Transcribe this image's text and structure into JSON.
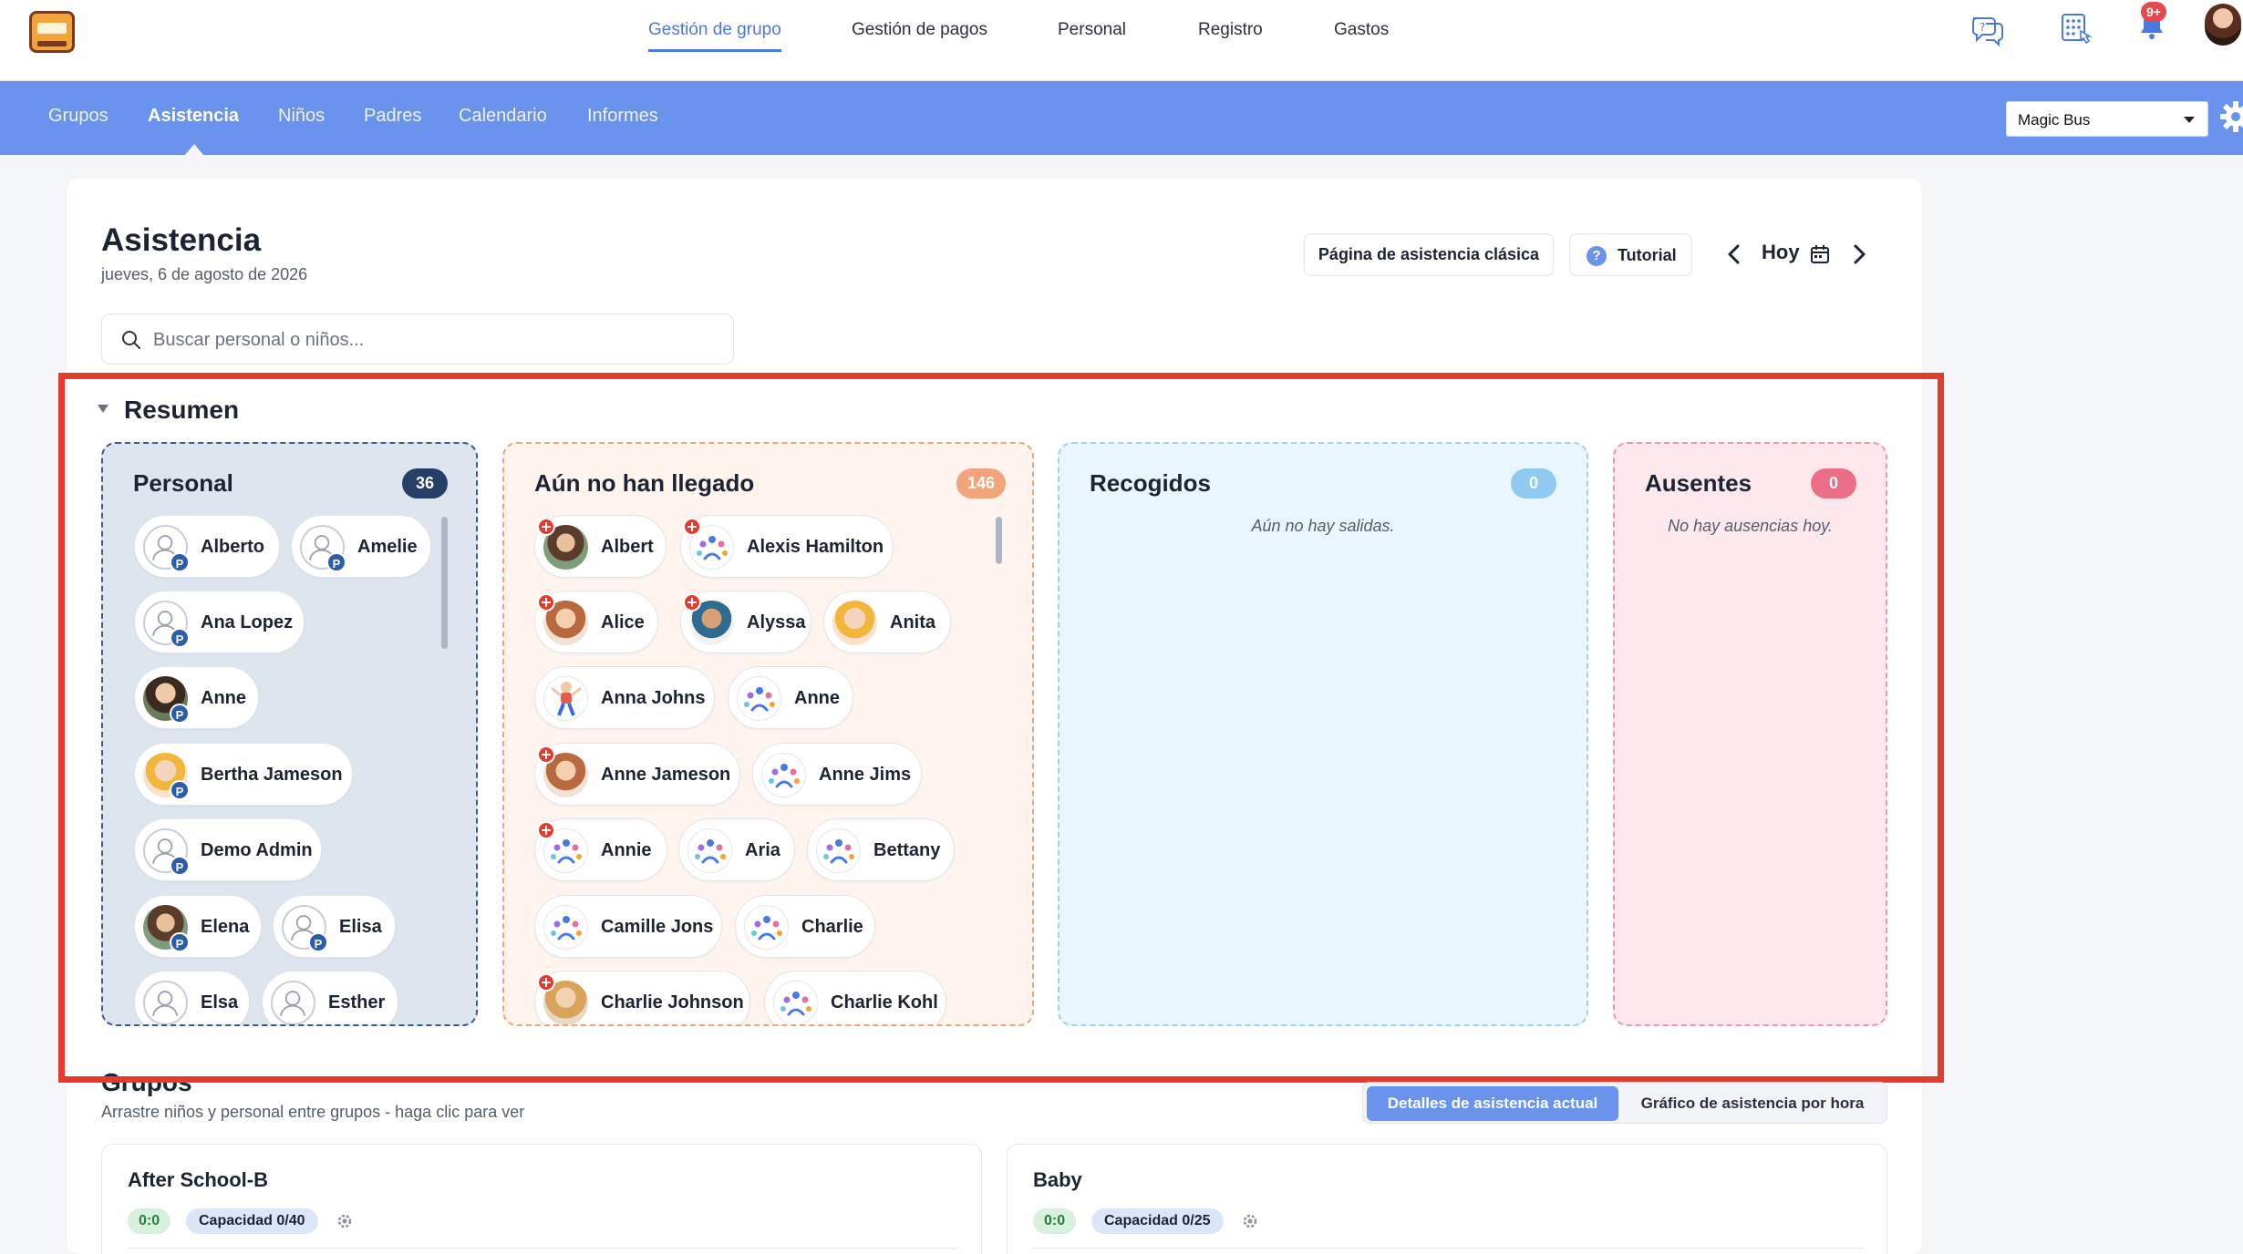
{
  "top_nav": {
    "items": [
      "Gestión de grupo",
      "Gestión de pagos",
      "Personal",
      "Registro",
      "Gastos"
    ],
    "active": "Gestión de grupo",
    "notifications_badge": "9+"
  },
  "sub_nav": {
    "items": [
      "Grupos",
      "Asistencia",
      "Niños",
      "Padres",
      "Calendario",
      "Informes"
    ],
    "active": "Asistencia",
    "bus_select": "Magic Bus"
  },
  "header": {
    "title": "Asistencia",
    "date": "jueves, 6 de agosto de 2026",
    "search_placeholder": "Buscar personal o niños...",
    "classic_button": "Página de asistencia clásica",
    "tutorial_button": "Tutorial",
    "today_label": "Hoy"
  },
  "resumen": {
    "title": "Resumen",
    "personal": {
      "title": "Personal",
      "count": "36",
      "people": [
        "Alberto",
        "Amelie",
        "Ana Lopez",
        "Anne",
        "Bertha Jameson",
        "Demo Admin",
        "Elena",
        "Elisa",
        "Elsa",
        "Esther"
      ]
    },
    "not_arrived": {
      "title": "Aún no han llegado",
      "count": "146",
      "children": [
        "Albert",
        "Alexis Hamilton",
        "Alice",
        "Alyssa",
        "Anita",
        "Anna Johns",
        "Anne",
        "Anne Jameson",
        "Anne Jims",
        "Annie",
        "Aria",
        "Bettany",
        "Camille Jons",
        "Charlie",
        "Charlie Johnson",
        "Charlie Kohl"
      ]
    },
    "picked_up": {
      "title": "Recogidos",
      "count": "0",
      "empty": "Aún no hay salidas."
    },
    "absent": {
      "title": "Ausentes",
      "count": "0",
      "empty": "No hay ausencias hoy."
    }
  },
  "grupos": {
    "title": "Grupos",
    "subtitle": "Arrastre niños y personal entre grupos - haga clic para ver",
    "toggle": [
      "Detalles de asistencia actual",
      "Gráfico de asistencia por hora"
    ],
    "cards": [
      {
        "name": "After School-B",
        "ratio": "0:0",
        "capacity": "Capacidad 0/40"
      },
      {
        "name": "Baby",
        "ratio": "0:0",
        "capacity": "Capacidad 0/25"
      }
    ]
  },
  "colors": {
    "accent": "#6a93ee",
    "highlight": "#e53b2c",
    "personal_bg": "#dde6ef",
    "notyet_bg": "#fff4ee",
    "picked_bg": "#eaf6fd",
    "absent_bg": "#fde8ee"
  }
}
